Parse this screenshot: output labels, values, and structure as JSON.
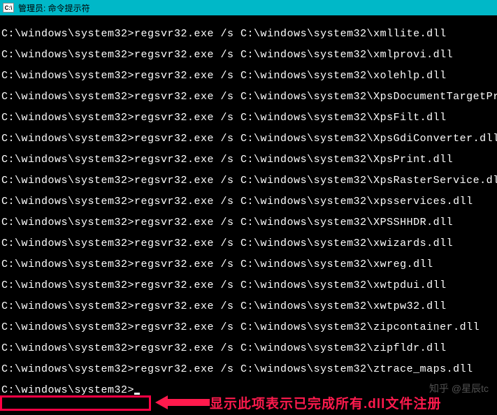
{
  "titlebar": {
    "icon_text": "C:\\",
    "title": "管理员: 命令提示符"
  },
  "terminal": {
    "prompt": "C:\\windows\\system32>",
    "cmd_prefix": "regsvr32.exe /s C:\\windows\\system32\\",
    "lines": [
      "xmllite.dll",
      "xmlprovi.dll",
      "xolehlp.dll",
      "XpsDocumentTargetPrint.dll",
      "XpsFilt.dll",
      "XpsGdiConverter.dll",
      "XpsPrint.dll",
      "XpsRasterService.dll",
      "xpsservices.dll",
      "XPSSHHDR.dll",
      "xwizards.dll",
      "xwreg.dll",
      "xwtpdui.dll",
      "xwtpw32.dll",
      "zipcontainer.dll",
      "zipfldr.dll",
      "ztrace_maps.dll"
    ],
    "final_prompt": "C:\\windows\\system32>"
  },
  "annotation": {
    "text": "显示此项表示已完成所有.dll文件注册"
  },
  "watermark": {
    "text": "知乎 @星辰tc"
  }
}
